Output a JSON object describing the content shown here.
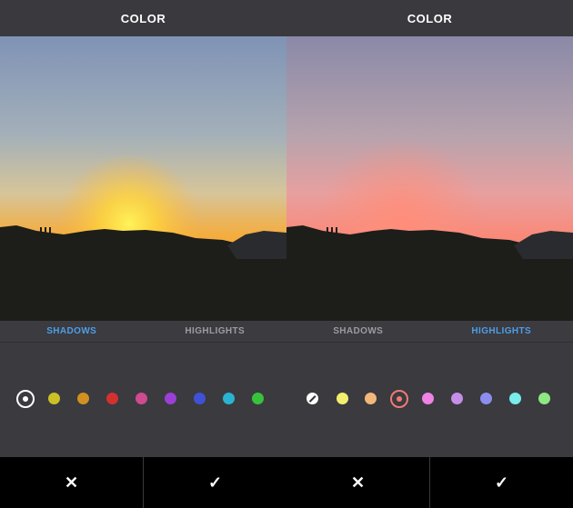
{
  "screens": [
    {
      "title": "COLOR",
      "tabs": [
        {
          "label": "SHADOWS",
          "active": true
        },
        {
          "label": "HIGHLIGHTS",
          "active": false
        }
      ],
      "swatches": [
        {
          "name": "none",
          "color": "#ffffff",
          "selected": true
        },
        {
          "name": "yellow",
          "color": "#cbc127"
        },
        {
          "name": "orange",
          "color": "#d1901f"
        },
        {
          "name": "red",
          "color": "#d33030"
        },
        {
          "name": "pink",
          "color": "#cf4a8e"
        },
        {
          "name": "purple",
          "color": "#9b40d4"
        },
        {
          "name": "blue",
          "color": "#4151d6"
        },
        {
          "name": "cyan",
          "color": "#2ab3d1"
        },
        {
          "name": "green",
          "color": "#38c23c"
        }
      ],
      "actions": {
        "cancel": "✕",
        "confirm": "✓"
      }
    },
    {
      "title": "COLOR",
      "tabs": [
        {
          "label": "SHADOWS",
          "active": false
        },
        {
          "label": "HIGHLIGHTS",
          "active": true
        }
      ],
      "swatches": [
        {
          "name": "none",
          "color": "#ffffff",
          "icon": "slash-icon"
        },
        {
          "name": "yellow",
          "color": "#f2ef6e"
        },
        {
          "name": "orange",
          "color": "#f2b77b"
        },
        {
          "name": "red",
          "color": "#f07a73",
          "selected": true
        },
        {
          "name": "pink",
          "color": "#ee83e4"
        },
        {
          "name": "purple",
          "color": "#c68de9"
        },
        {
          "name": "blue",
          "color": "#8b8eee"
        },
        {
          "name": "cyan",
          "color": "#79ecec"
        },
        {
          "name": "green",
          "color": "#8ee783"
        }
      ],
      "actions": {
        "cancel": "✕",
        "confirm": "✓"
      }
    }
  ]
}
